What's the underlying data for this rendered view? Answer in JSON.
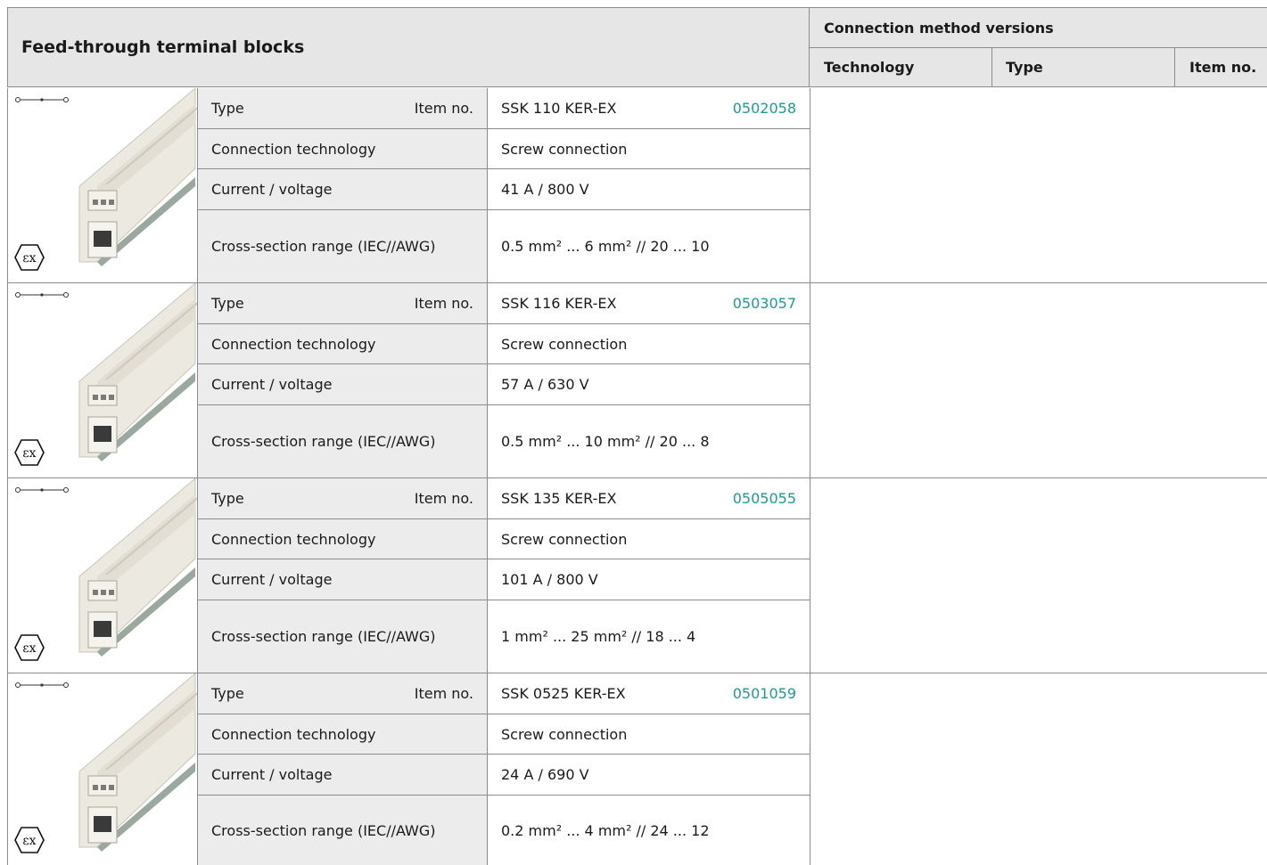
{
  "header": {
    "title": "Feed-through terminal blocks",
    "versions_title": "Connection method versions",
    "col_technology": "Technology",
    "col_type": "Type",
    "col_item_no": "Item no."
  },
  "labels": {
    "type": "Type",
    "item_no": "Item no.",
    "connection_technology": "Connection technology",
    "current_voltage": "Current / voltage",
    "cross_section": "Cross-section range (IEC//AWG)"
  },
  "products": [
    {
      "type": "SSK 110 KER-EX",
      "item_no": "0502058",
      "connection": "Screw connection",
      "current_voltage": "41 A / 800 V",
      "cross_section": "0.5 mm² ... 6 mm² // 20 ... 10"
    },
    {
      "type": "SSK 116 KER-EX",
      "item_no": "0503057",
      "connection": "Screw connection",
      "current_voltage": "57 A / 630 V",
      "cross_section": "0.5 mm² ... 10 mm² // 20 ... 8"
    },
    {
      "type": "SSK 135 KER-EX",
      "item_no": "0505055",
      "connection": "Screw connection",
      "current_voltage": "101 A / 800 V",
      "cross_section": "1 mm² ... 25 mm² // 18 ... 4"
    },
    {
      "type": "SSK 0525 KER-EX",
      "item_no": "0501059",
      "connection": "Screw connection",
      "current_voltage": "24 A / 690 V",
      "cross_section": "0.2 mm² ... 4 mm² // 24 ... 12"
    }
  ],
  "colors": {
    "accent": "#1a9b96",
    "header_bg": "#e6e6e6",
    "label_bg": "#ececec"
  },
  "icons": {
    "symbol": "feed-through-symbol-icon",
    "ex": "ex-explosion-protection-icon"
  }
}
